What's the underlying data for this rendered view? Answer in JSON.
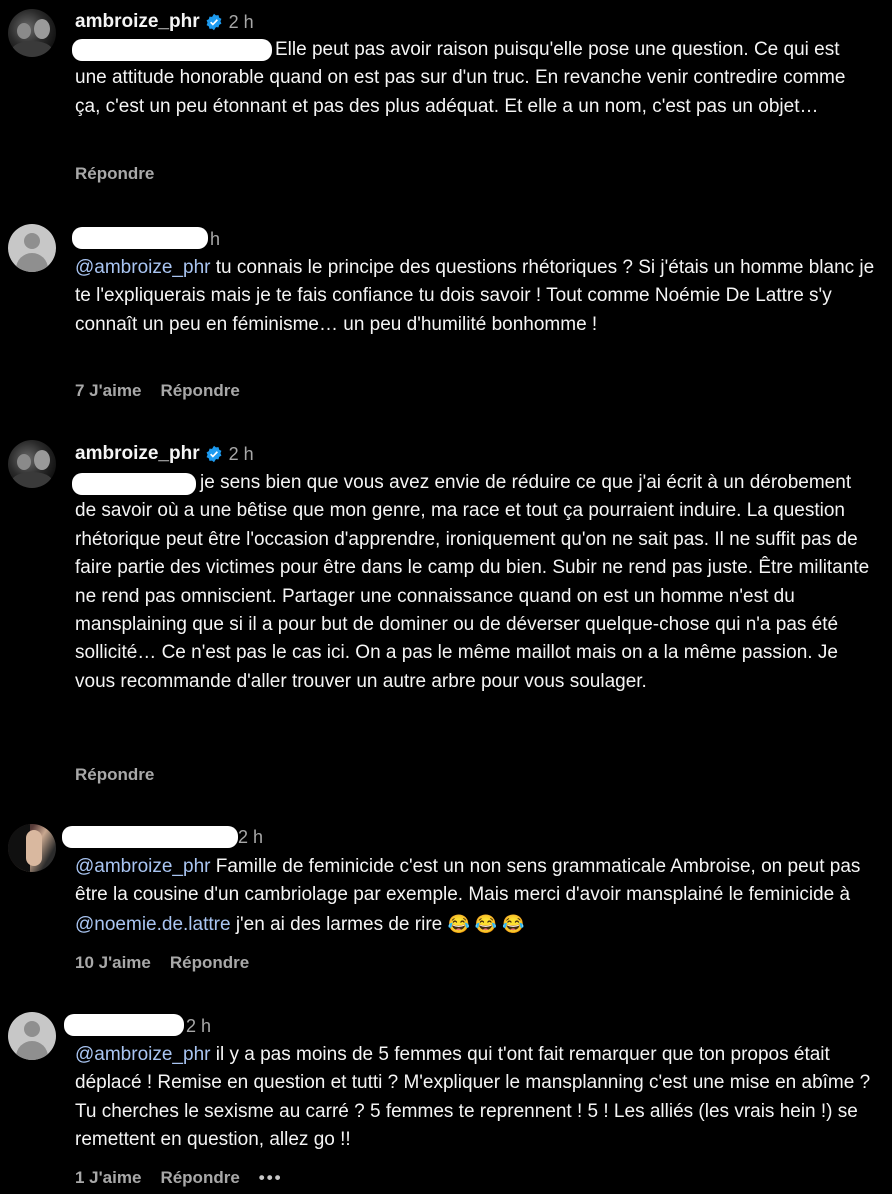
{
  "comments": [
    {
      "username": "ambroize_phr",
      "time": "2 h",
      "text": "Elle peut pas avoir raison puisqu'elle pose une question. Ce qui est une attitude honorable quand on est pas sur d'un truc. En revanche venir contredire comme ça, c'est un peu étonnant et pas des plus adéquat. Et elle a un nom, c'est pas un objet…",
      "reply": "Répondre"
    },
    {
      "time": "h",
      "mention": "@ambroize_phr",
      "text": " tu connais le principe des questions rhétoriques ? Si j'étais un homme blanc je te l'expliquerais mais je te fais confiance tu dois savoir ! Tout comme Noémie De Lattre s'y connaît un peu en féminisme… un peu d'humilité bonhomme !",
      "likes": "7 J'aime",
      "reply": "Répondre"
    },
    {
      "username": "ambroize_phr",
      "time": "2 h",
      "text": "je sens bien que vous avez envie de réduire ce que j'ai écrit à un dérobement de savoir où a une bêtise que mon genre, ma race et tout ça pourraient induire. La question rhétorique peut être l'occasion d'apprendre, ironiquement qu'on ne sait pas. Il ne suffit pas de faire partie des victimes pour être dans le camp du bien. Subir ne rend pas juste. Être militante ne rend pas omniscient. Partager une connaissance quand on est un homme n'est du mansplaining que si il a pour but de dominer ou de déverser quelque-chose qui n'a pas été sollicité… Ce n'est pas le cas ici. On a pas le même maillot mais on a la même passion. Je vous recommande d'aller trouver un autre arbre pour vous soulager.",
      "reply": "Répondre"
    },
    {
      "time": "2 h",
      "mention": "@ambroize_phr",
      "text_a": " Famille de feminicide c'est un non sens grammaticale Ambroise, on peut pas être la cousine d'un cambriolage par exemple. Mais merci d'avoir mansplainé le feminicide à ",
      "mention2": "@noemie.de.lattre",
      "text_b": " j'en ai des larmes de rire ",
      "emojis": "😂 😂 😂",
      "likes": "10 J'aime",
      "reply": "Répondre"
    },
    {
      "time": "2 h",
      "mention": "@ambroize_phr",
      "text": " il y a pas moins de 5 femmes qui t'ont fait remarquer que ton propos était déplacé ! Remise en question et tutti ? M'expliquer le mansplanning c'est une mise en abîme ? Tu cherches le sexisme au carré ? 5 femmes te reprennent ! 5 ! Les alliés (les vrais hein !) se remettent en question, allez go !!",
      "likes": "1 J'aime",
      "reply": "Répondre",
      "more": "•••"
    }
  ],
  "colors": {
    "mention": "#a9c5f2",
    "verified": "#1d9bf0",
    "muted": "#a8a8a8"
  },
  "icons": {
    "verified": "verified-badge-icon",
    "more": "more-options-icon"
  }
}
